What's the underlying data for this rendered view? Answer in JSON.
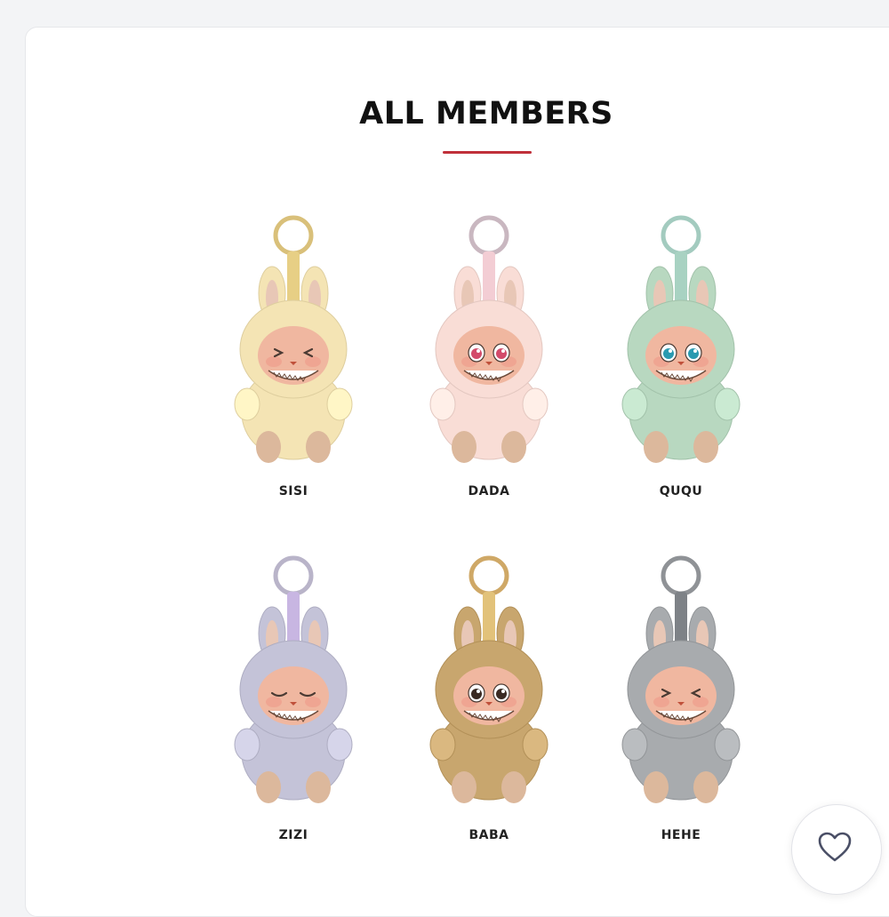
{
  "section": {
    "title": "ALL MEMBERS",
    "accent_color": "#c0303a"
  },
  "members": [
    {
      "name": "SISI",
      "fur_color": "#f4e4b4",
      "ring_color": "#d9c07a",
      "eyes": "closed-squint",
      "strap_color": "#e7cf85"
    },
    {
      "name": "DADA",
      "fur_color": "#f9ddd6",
      "ring_color": "#c9b7c0",
      "eyes": "open-pink",
      "strap_color": "#f3cdd4"
    },
    {
      "name": "QUQU",
      "fur_color": "#b8d8c0",
      "ring_color": "#a3cbbf",
      "eyes": "open-teal",
      "strap_color": "#a8d2c2"
    },
    {
      "name": "ZIZI",
      "fur_color": "#c4c3d8",
      "ring_color": "#b9b4c9",
      "eyes": "closed-sleepy",
      "strap_color": "#c8b6e2"
    },
    {
      "name": "BABA",
      "fur_color": "#c8a66e",
      "ring_color": "#cfa866",
      "eyes": "open-brown",
      "strap_color": "#e2c27a"
    },
    {
      "name": "HEHE",
      "fur_color": "#a8abae",
      "ring_color": "#8f9296",
      "eyes": "closed-squint",
      "strap_color": "#7e8287"
    }
  ],
  "favorite_button": {
    "icon": "heart-outline-icon",
    "icon_color": "#4a4f66"
  }
}
